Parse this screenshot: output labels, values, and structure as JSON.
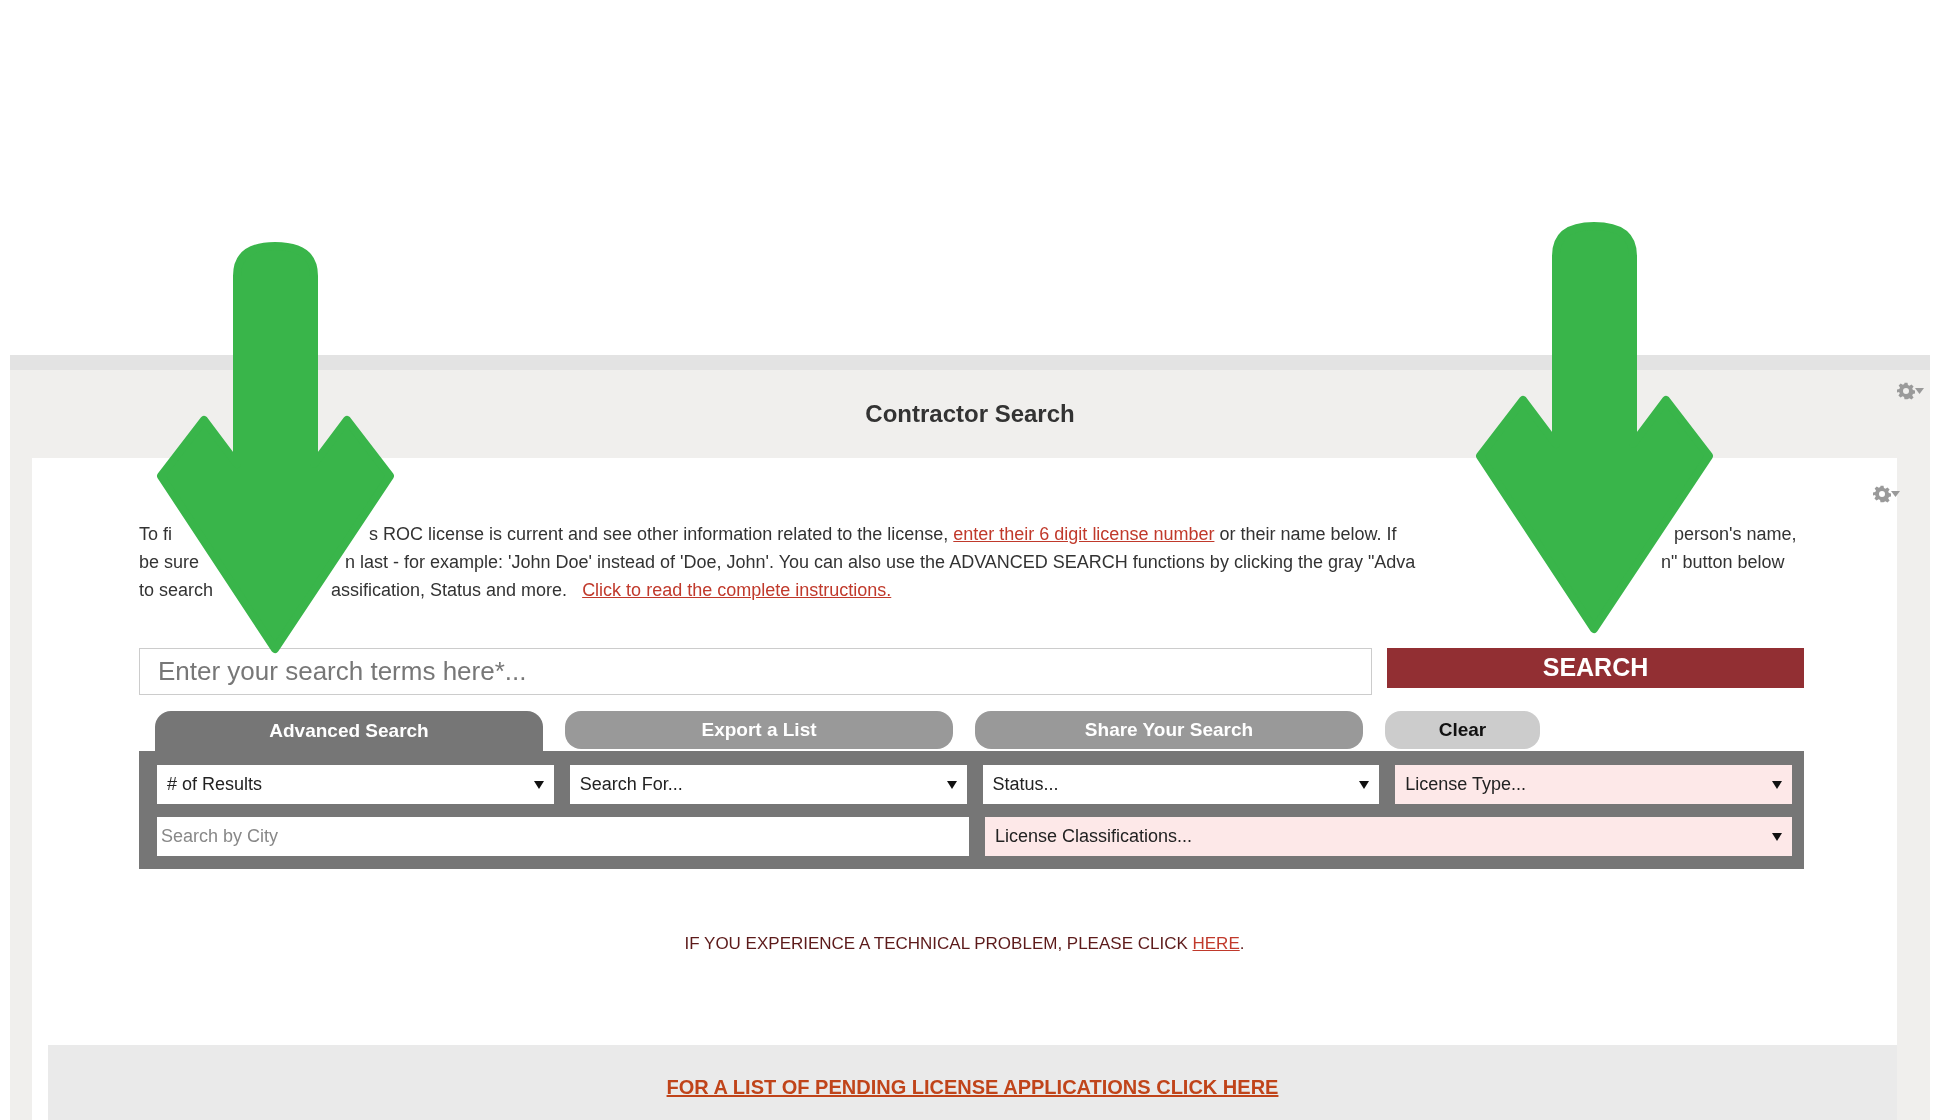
{
  "panel": {
    "title": "Contractor Search"
  },
  "intro": {
    "lines": [
      {
        "fragments": [
          {
            "runs": [
              {
                "kind": "text",
                "text": "To fi"
              }
            ]
          },
          {
            "runs": [
              {
                "kind": "text",
                "text": "s ROC license is current and see other information related to the license, "
              },
              {
                "kind": "link",
                "text": "enter their 6 digit license number"
              },
              {
                "kind": "text",
                "text": " or their name below. If"
              }
            ]
          },
          {
            "runs": [
              {
                "kind": "text",
                "text": "person's name,"
              }
            ]
          }
        ]
      },
      {
        "fragments": [
          {
            "runs": [
              {
                "kind": "text",
                "text": "be sure"
              }
            ]
          },
          {
            "runs": [
              {
                "kind": "text",
                "text": "n last - for example: 'John Doe' instead of 'Doe, John'. You can also use the ADVANCED SEARCH functions by clicking the gray \"Adva"
              }
            ]
          },
          {
            "runs": [
              {
                "kind": "text",
                "text": "n\" button below"
              }
            ]
          }
        ]
      },
      {
        "fragments": [
          {
            "runs": [
              {
                "kind": "text",
                "text": "to search"
              }
            ]
          },
          {
            "runs": [
              {
                "kind": "text",
                "text": "assification, Status and more.   "
              },
              {
                "kind": "link",
                "text": "Click to read the complete instructions."
              }
            ]
          }
        ]
      }
    ]
  },
  "search": {
    "placeholder": "Enter your search terms here*...",
    "button": "SEARCH"
  },
  "tabs": [
    {
      "kind": "tab",
      "label": "Advanced Search",
      "selected": true
    },
    {
      "kind": "tab",
      "label": "Export a List",
      "selected": false
    },
    {
      "kind": "tab",
      "label": "Share Your Search",
      "selected": false
    },
    {
      "kind": "button",
      "label": "Clear",
      "selected": false
    }
  ],
  "filters": [
    [
      {
        "kind": "select",
        "label": "# of Results",
        "required": false
      },
      {
        "kind": "select",
        "label": "Search For...",
        "required": false
      },
      {
        "kind": "select",
        "label": "Status...",
        "required": false
      },
      {
        "kind": "select",
        "label": "License Type...",
        "required": true
      }
    ],
    [
      {
        "kind": "input",
        "placeholder": "Search by City"
      },
      {
        "kind": "select",
        "label": "License Classifications...",
        "required": true
      }
    ]
  ],
  "notice": {
    "text": "IF YOU EXPERIENCE A TECHNICAL PROBLEM, PLEASE CLICK ",
    "link": "HERE",
    "end": "."
  },
  "footer": {
    "link": "FOR A LIST OF PENDING LICENSE APPLICATIONS CLICK HERE"
  }
}
